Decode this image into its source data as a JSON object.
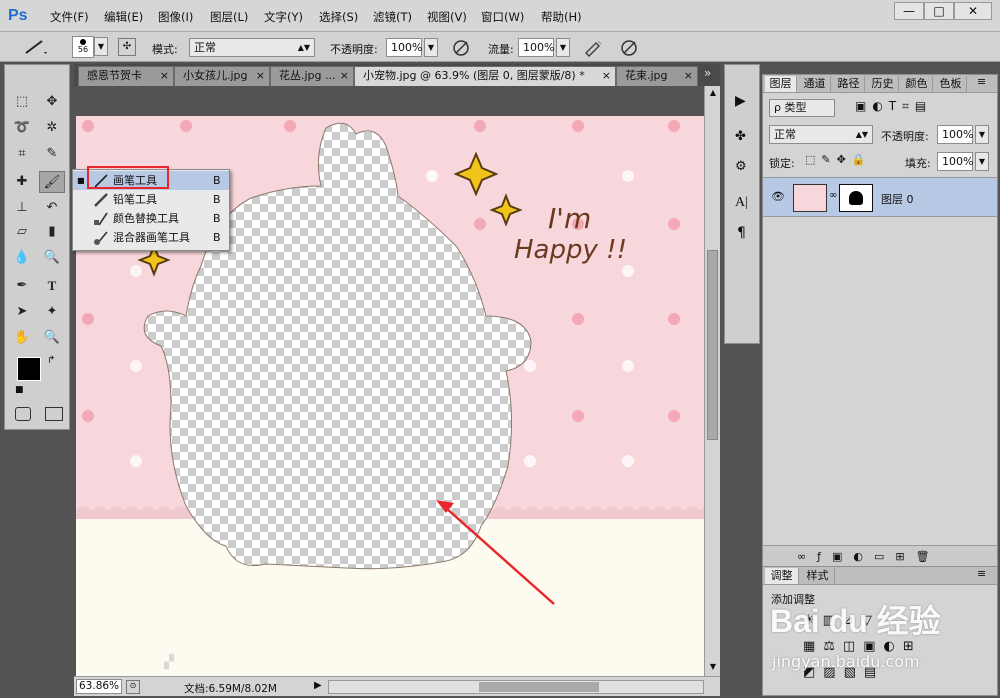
{
  "app": {
    "logo": "Ps"
  },
  "menu": [
    "文件(F)",
    "编辑(E)",
    "图像(I)",
    "图层(L)",
    "文字(Y)",
    "选择(S)",
    "滤镜(T)",
    "视图(V)",
    "窗口(W)",
    "帮助(H)"
  ],
  "window_buttons": [
    "—",
    "□",
    "✕"
  ],
  "options": {
    "brush_size": "56",
    "mode_label": "模式:",
    "mode_value": "正常",
    "opacity_label": "不透明度:",
    "opacity_value": "100%",
    "flow_label": "流量:",
    "flow_value": "100%"
  },
  "tabs": [
    {
      "label": "感恩节贺卡",
      "active": false
    },
    {
      "label": "小女孩儿.jpg",
      "active": false
    },
    {
      "label": "花丛.jpg ...",
      "active": false
    },
    {
      "label": "小宠物.jpg @ 63.9% (图层 0, 图层蒙版/8) *",
      "active": true
    },
    {
      "label": "花束.jpg",
      "active": false
    }
  ],
  "tabs_more": "»",
  "flyout": [
    {
      "label": "画笔工具",
      "shortcut": "B",
      "selected": true
    },
    {
      "label": "铅笔工具",
      "shortcut": "B",
      "selected": false
    },
    {
      "label": "颜色替换工具",
      "shortcut": "B",
      "selected": false
    },
    {
      "label": "混合器画笔工具",
      "shortcut": "B",
      "selected": false
    }
  ],
  "canvas_text": {
    "line1": "I'm",
    "line2": "Happy !!"
  },
  "status": {
    "zoom": "63.86%",
    "doc": "文档:6.59M/8.02M"
  },
  "layers_panel": {
    "tabs": [
      "图层",
      "通道",
      "路径",
      "历史",
      "颜色",
      "色板"
    ],
    "filter_label": "ρ 类型",
    "blend_mode": "正常",
    "opacity_label": "不透明度:",
    "opacity_value": "100%",
    "lock_label": "锁定:",
    "fill_label": "填充:",
    "fill_value": "100%",
    "layer_name": "图层 0"
  },
  "adj_panel": {
    "tabs": [
      "调整",
      "样式"
    ],
    "title": "添加调整"
  },
  "watermark": {
    "brand": "Bai du 经验",
    "url": "jingyan.baidu.com"
  },
  "colors": {
    "accent_red": "#e8262b",
    "canvas_pink": "#f7d6dc",
    "canvas_cream": "#fdfbef",
    "layer_selected": "#b8c9e6"
  }
}
